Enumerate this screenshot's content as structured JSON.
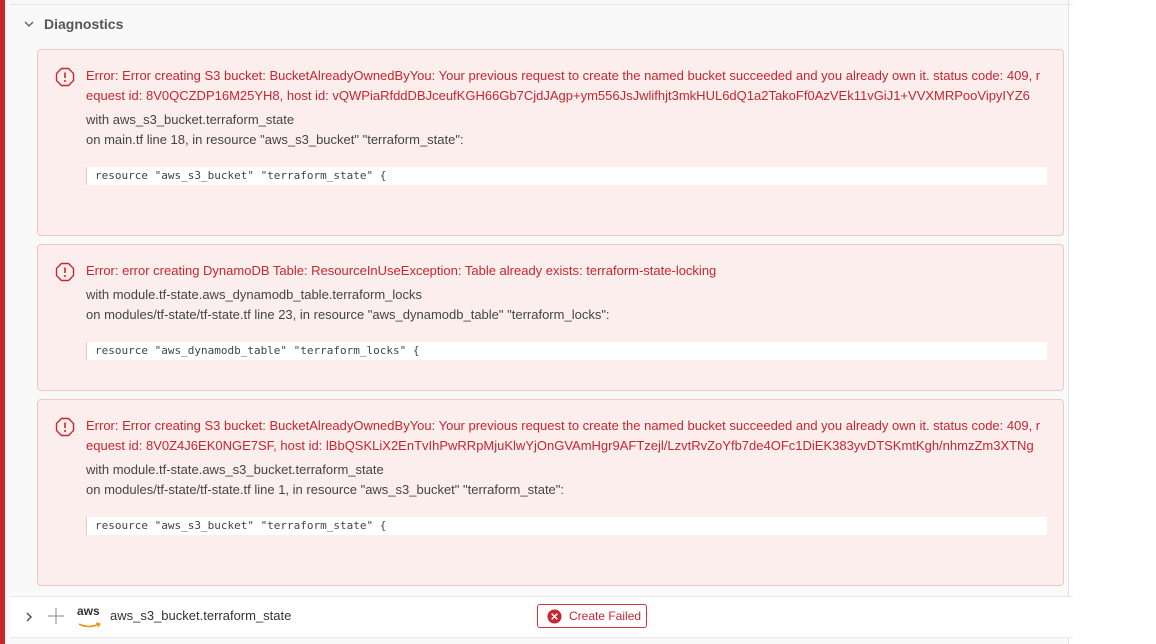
{
  "diagnostics": {
    "title": "Diagnostics",
    "errors": [
      {
        "message": "Error: Error creating S3 bucket: BucketAlreadyOwnedByYou: Your previous request to create the named bucket succeeded and you already own it. status code: 409, request id: 8V0QCZDP16M25YH8, host id: vQWPiaRfddDBJceufKGH66Gb7CjdJAgp+ym556JsJwlifhjt3mkHUL6dQ1a2TakoFf0AzVEk11vGiJ1+VVXMRPooVipyIYZ6",
        "with": "with aws_s3_bucket.terraform_state",
        "on": "on main.tf line 18, in resource \"aws_s3_bucket\" \"terraform_state\":",
        "code": "resource \"aws_s3_bucket\" \"terraform_state\" {"
      },
      {
        "message": "Error: error creating DynamoDB Table: ResourceInUseException: Table already exists: terraform-state-locking",
        "with": "with module.tf-state.aws_dynamodb_table.terraform_locks",
        "on": "on modules/tf-state/tf-state.tf line 23, in resource \"aws_dynamodb_table\" \"terraform_locks\":",
        "code": "resource \"aws_dynamodb_table\" \"terraform_locks\" {"
      },
      {
        "message": "Error: Error creating S3 bucket: BucketAlreadyOwnedByYou: Your previous request to create the named bucket succeeded and you already own it. status code: 409, request id: 8V0Z4J6EK0NGE7SF, host id: lBbQSKLiX2EnTvIhPwRRpMjuKlwYjOnGVAmHgr9AFTzejl/LzvtRvZoYfb7de4OFc1DiEK383yvDTSKmtKgh/nhmzZm3XTNg",
        "with": "with module.tf-state.aws_s3_bucket.terraform_state",
        "on": "on modules/tf-state/tf-state.tf line 1, in resource \"aws_s3_bucket\" \"terraform_state\":",
        "code": "resource \"aws_s3_bucket\" \"terraform_state\" {"
      }
    ]
  },
  "resource": {
    "provider_logo_text": "aws",
    "name": "aws_s3_bucket.terraform_state",
    "status": "Create Failed"
  },
  "colors": {
    "error_red": "#c6262e",
    "error_bg": "#fdeeee",
    "left_bar": "#c9252c"
  },
  "icons": {
    "collapse": "chevron-down-icon",
    "expand": "chevron-right-icon",
    "error": "error-octagon-icon",
    "create": "plus-icon",
    "provider": "aws-logo",
    "status": "close-circle-icon"
  }
}
